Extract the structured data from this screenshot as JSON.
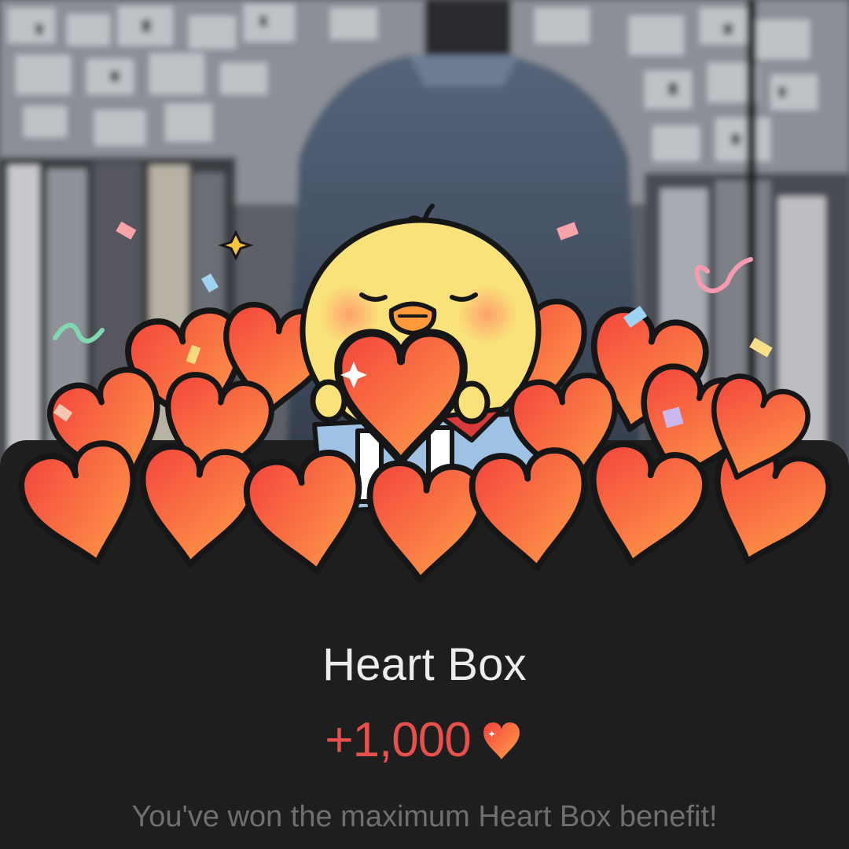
{
  "reward_popup": {
    "title": "Heart Box",
    "amount": "+1,000",
    "amount_icon": "heart-icon",
    "message": "You've won the maximum Heart Box benefit!"
  },
  "illustration": {
    "character": "yellow chick hugging a heart",
    "icons": [
      "confetti",
      "sparkle-icon",
      "gift-box-icon",
      "heart-icon"
    ]
  },
  "colors": {
    "background": "#1e1e1f",
    "accent": "#e8514b",
    "title": "#ececec",
    "message": "#6f6f71"
  }
}
